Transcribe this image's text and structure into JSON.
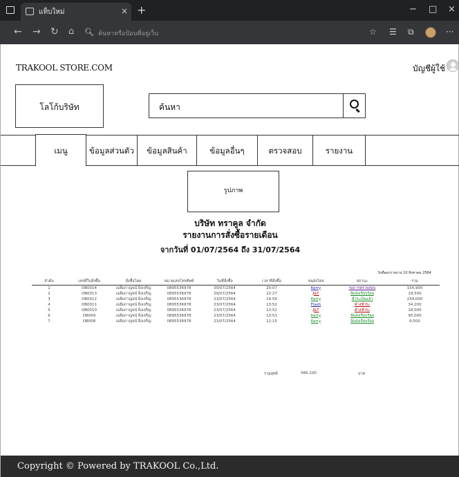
{
  "browser": {
    "tab_title": "แท็บใหม่",
    "tab_close": "×",
    "new_tab": "+",
    "address_placeholder": "ค้นหาหรือป้อนที่อยู่เว็บ",
    "window_controls": {
      "minimize": "−",
      "maximize": "□",
      "close": "×"
    },
    "more": "···"
  },
  "header": {
    "store_name": "TRAKOOL STORE.COM",
    "account_label": "บัญชีผู้ใช้"
  },
  "logo": {
    "label": "โลโก้บริษัท"
  },
  "search": {
    "placeholder": "ค้นหา"
  },
  "menu": {
    "items": [
      {
        "label": "เมนู"
      },
      {
        "label": "ข้อมูลส่วนตัว"
      },
      {
        "label": "ข้อมูลสินค้า"
      },
      {
        "label": "ข้อมูลอื่นๆ"
      },
      {
        "label": "ตรวจสอบ"
      },
      {
        "label": "รายงาน"
      }
    ]
  },
  "picture": {
    "label": "รูปภาพ"
  },
  "report": {
    "company": "บริษัท ทราคูล จำกัด",
    "title": "รายงานการสั่งซื้อรายเดือน",
    "range": "จากวันที่ 01/07/2564 ถึง 31/07/2564",
    "print_date": "วันที่ออกรายงาน 10 สิงหาคม 2564",
    "columns": [
      "ลำดับ",
      "เลขที่ใบสั่งซื้อ",
      "สั่งซื้อโดย",
      "หมายเลขโทรศัพท์",
      "วันที่สั่งซื้อ",
      "เวลาที่สั่งซื้อ",
      "ขนส่งโดย",
      "สถานะ",
      "รวม"
    ],
    "rows": [
      {
        "no": "1",
        "order": "OB0014",
        "buyer": "เฉลิมกาญจน์ ยิ่งเจริญ",
        "phone": "0895536978",
        "date": "30/07/2564",
        "time": "20:07",
        "carrier": "Kerry",
        "status": "รอการตรวจสอบ",
        "total": "154,900"
      },
      {
        "no": "2",
        "order": "OB0013",
        "buyer": "เฉลิมกาญจน์ ยิ่งเจริญ",
        "phone": "0895536978",
        "date": "29/07/2564",
        "time": "22:27",
        "carrier": "J&T",
        "status": "จัดส่งเรียบร้อย",
        "total": "19,500"
      },
      {
        "no": "3",
        "order": "OB0012",
        "buyer": "เฉลิมกาญจน์ ยิ่งเจริญ",
        "phone": "0895536978",
        "date": "23/07/2564",
        "time": "19:50",
        "carrier": "Kerry",
        "status": "ชำระเงินแล้ว",
        "total": "234,000"
      },
      {
        "no": "4",
        "order": "OB0011",
        "buyer": "เฉลิมกาญจน์ ยิ่งเจริญ",
        "phone": "0895536978",
        "date": "23/07/2564",
        "time": "13:52",
        "carrier": "Flash",
        "status": "ค้างชำระ",
        "total": "34,200"
      },
      {
        "no": "5",
        "order": "OB0010",
        "buyer": "เฉลิมกาญจน์ ยิ่งเจริญ",
        "phone": "0895536978",
        "date": "23/07/2564",
        "time": "13:52",
        "carrier": "J&T",
        "status": "ค้างชำระ",
        "total": "18,000"
      },
      {
        "no": "6",
        "order": "OB009",
        "buyer": "เฉลิมกาญจน์ ยิ่งเจริญ",
        "phone": "0895536978",
        "date": "23/07/2564",
        "time": "13:51",
        "carrier": "Kerry",
        "status": "จัดส่งเรียบร้อย",
        "total": "95,000"
      },
      {
        "no": "7",
        "order": "OB008",
        "buyer": "เฉลิมกาญจน์ ยิ่งเจริญ",
        "phone": "0895536978",
        "date": "23/07/2564",
        "time": "12:15",
        "carrier": "Kerry",
        "status": "จัดส่งเรียบร้อย",
        "total": "9,500"
      }
    ],
    "total_label": "รวมสุทธิ",
    "total_value": "566,100",
    "currency": "บาท"
  },
  "footer": {
    "text": "Copyright © Powered by TRAKOOL Co.,Ltd."
  }
}
